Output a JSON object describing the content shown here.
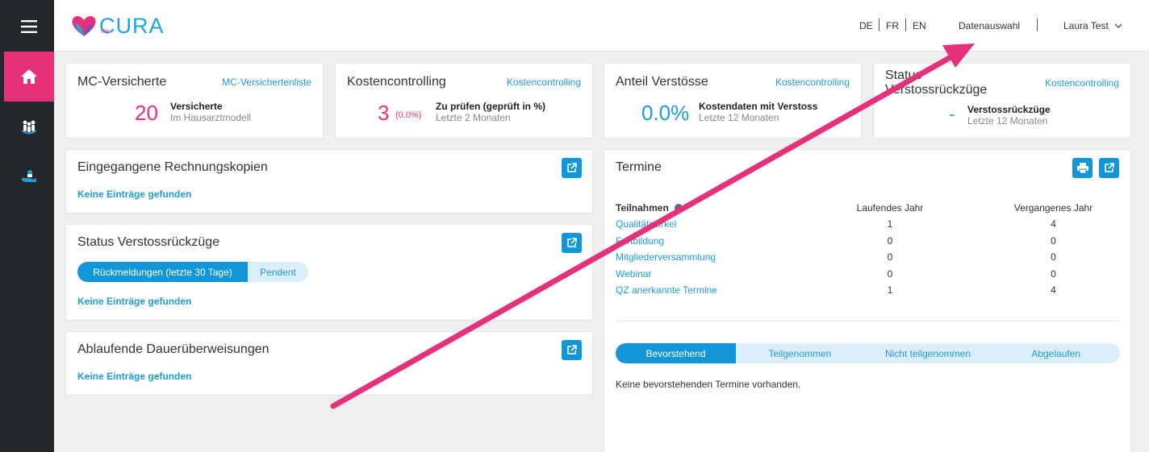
{
  "sidebar": {
    "items": [
      {
        "name": "menu-icon"
      },
      {
        "name": "home-icon"
      },
      {
        "name": "patients-icon"
      },
      {
        "name": "care-hand-icon"
      }
    ]
  },
  "header": {
    "logo_my": "my",
    "logo_text": "CURA",
    "languages": [
      "DE",
      "FR",
      "EN"
    ],
    "data_selection": "Datenauswahl",
    "user": "Laura Test"
  },
  "kpis": [
    {
      "title": "MC-Versicherte",
      "link": "MC-Versichertenliste",
      "value": "20",
      "extra": "",
      "label": "Versicherte",
      "sub": "Im Hausarztmodell",
      "color": "#e5317a"
    },
    {
      "title": "Kostencontrolling",
      "link": "Kostencontrolling",
      "value": "3",
      "extra": "(0.0%)",
      "label": "Zu prüfen (geprüft in %)",
      "sub": "Letzte 2 Monaten",
      "color": "#e5317a"
    },
    {
      "title": "Anteil Verstösse",
      "link": "Kostencontrolling",
      "value": "0.0%",
      "extra": "",
      "label": "Kostendaten mit Verstoss",
      "sub": "Letzte 12 Monaten",
      "color": "#1e9bd7"
    },
    {
      "title": "Status Verstossrückzüge",
      "link": "Kostencontrolling",
      "value": "-",
      "extra": "",
      "label": "Verstossrückzüge",
      "sub": "Letzte 12 Monaten",
      "color": "#1e9bd7"
    }
  ],
  "rechnungskopien": {
    "title": "Eingegangene Rechnungskopien",
    "empty": "Keine Einträge gefunden"
  },
  "verstoss": {
    "title": "Status Verstossrückzüge",
    "pills": [
      "Rückmeldungen (letzte 30 Tage)",
      "Pendent"
    ],
    "empty": "Keine Einträge gefunden"
  },
  "dauer": {
    "title": "Ablaufende Dauerüberweisungen",
    "empty": "Keine Einträge gefunden"
  },
  "termine": {
    "title": "Termine",
    "columns": [
      "Teilnahmen",
      "Laufendes Jahr",
      "Vergangenes Jahr"
    ],
    "rows": [
      [
        "Qualitätszirkel",
        "1",
        "4"
      ],
      [
        "Fortbildung",
        "0",
        "0"
      ],
      [
        "Mitgliederversammlung",
        "0",
        "0"
      ],
      [
        "Webinar",
        "0",
        "0"
      ],
      [
        "QZ anerkannte Termine",
        "1",
        "4"
      ]
    ],
    "tabs": [
      "Bevorstehend",
      "Teilgenommen",
      "Nicht teilgenommen",
      "Abgelaufen"
    ],
    "empty": "Keine bevorstehenden Termine vorhanden."
  },
  "colors": {
    "accent": "#e5317a",
    "primary": "#1296d8",
    "sidebar": "#23272b"
  }
}
